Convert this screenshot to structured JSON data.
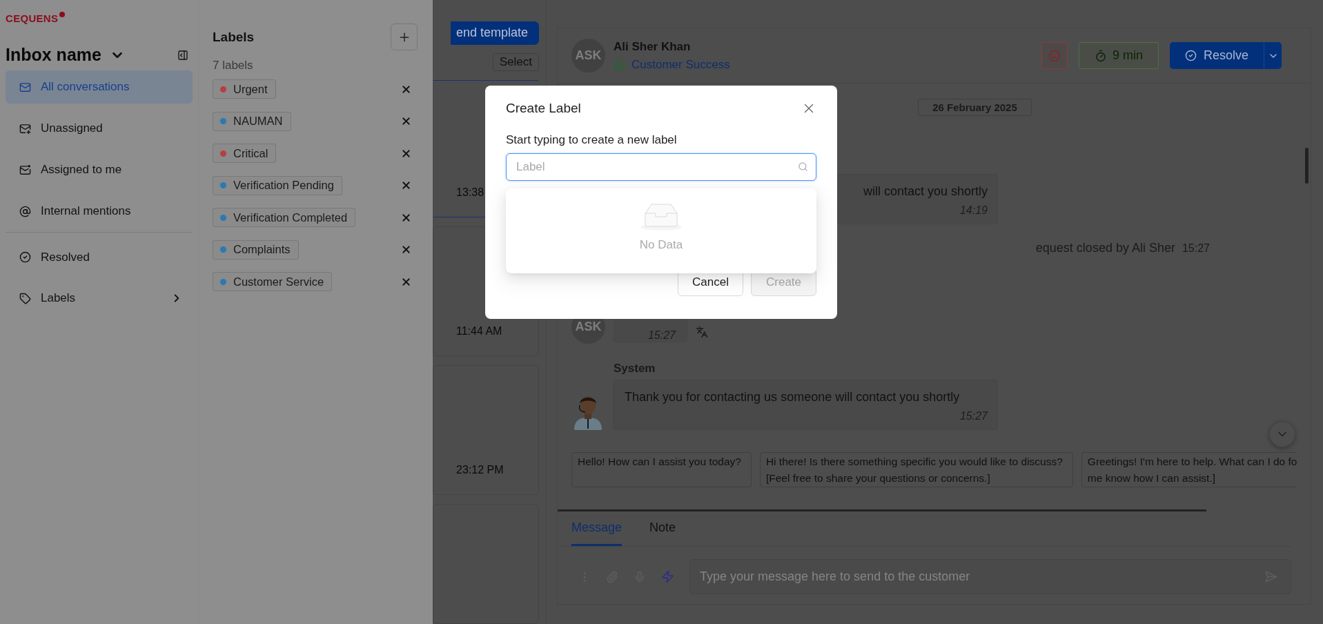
{
  "logo": {
    "text": "CEQUENS"
  },
  "inbox": {
    "title": "Inbox name"
  },
  "nav": [
    {
      "label": "All conversations",
      "selected": true,
      "divider_before": false,
      "has_submenu": false
    },
    {
      "label": "Unassigned",
      "selected": false,
      "divider_before": false,
      "has_submenu": false
    },
    {
      "label": "Assigned to me",
      "selected": false,
      "divider_before": false,
      "has_submenu": false
    },
    {
      "label": "Internal mentions",
      "selected": false,
      "divider_before": false,
      "has_submenu": false
    },
    {
      "label": "Resolved",
      "selected": false,
      "divider_before": true,
      "has_submenu": false
    },
    {
      "label": "Labels",
      "selected": false,
      "divider_before": false,
      "has_submenu": true
    }
  ],
  "labels_panel": {
    "title": "Labels",
    "count": "7 labels",
    "labels": [
      {
        "name": "Urgent",
        "color": "#b5403d"
      },
      {
        "name": "NAUMAN",
        "color": "#2a7ab0"
      },
      {
        "name": "Critical",
        "color": "#b5403d"
      },
      {
        "name": "Verification Pending",
        "color": "#2a7ab0"
      },
      {
        "name": "Verification Completed",
        "color": "#2a7ab0"
      },
      {
        "name": "Complaints",
        "color": "#2a7ab0"
      },
      {
        "name": "Customer Service",
        "color": "#2a7ab0"
      }
    ]
  },
  "conversation_list": {
    "template_button": "end template",
    "select_button": "Select",
    "items": [
      {
        "time": "13:38",
        "selected": true
      },
      {
        "time": "11:44 AM",
        "selected": false
      },
      {
        "time": "23:12 PM",
        "selected": false
      },
      {
        "selected": false
      }
    ]
  },
  "chat": {
    "contact": {
      "initials": "ASK",
      "name": "Ali Sher Khan",
      "channel": "Customer Success"
    },
    "timer": "9 min",
    "resolve_button": "Resolve",
    "date": "26 February 2025",
    "messages": [
      {
        "kind": "bubble",
        "text": "will contact you shortly",
        "time": "14:19"
      },
      {
        "kind": "event",
        "text": "equest closed by Ali Sher",
        "time": "15:27"
      },
      {
        "kind": "customer",
        "initials": "ASK",
        "time": "15:27"
      },
      {
        "kind": "agent",
        "sender": "System",
        "text": "Thank you for contacting us someone will contact you shortly",
        "time": "15:27"
      }
    ],
    "suggestions": [
      {
        "lines": [
          "Hello! How can I assist you today?"
        ]
      },
      {
        "lines": [
          "Hi there! Is there something specific you would like to discuss?",
          "[Feel free to share your questions or concerns.]"
        ]
      },
      {
        "lines": [
          "Greetings! I'm here to help. What can I do fo",
          "me know how I can assist.]"
        ]
      }
    ]
  },
  "composer": {
    "tabs": [
      {
        "label": "Message",
        "selected": true
      },
      {
        "label": "Note",
        "selected": false
      }
    ],
    "placeholder": "Type your message here to send to the customer"
  },
  "modal": {
    "title": "Create Label",
    "field_label": "Start typing to create a new label",
    "placeholder": "Label",
    "empty_text": "No Data",
    "buttons": [
      {
        "label": "Cancel",
        "kind": "default",
        "disabled": false
      },
      {
        "label": "Create",
        "kind": "primary",
        "disabled": true
      }
    ]
  }
}
